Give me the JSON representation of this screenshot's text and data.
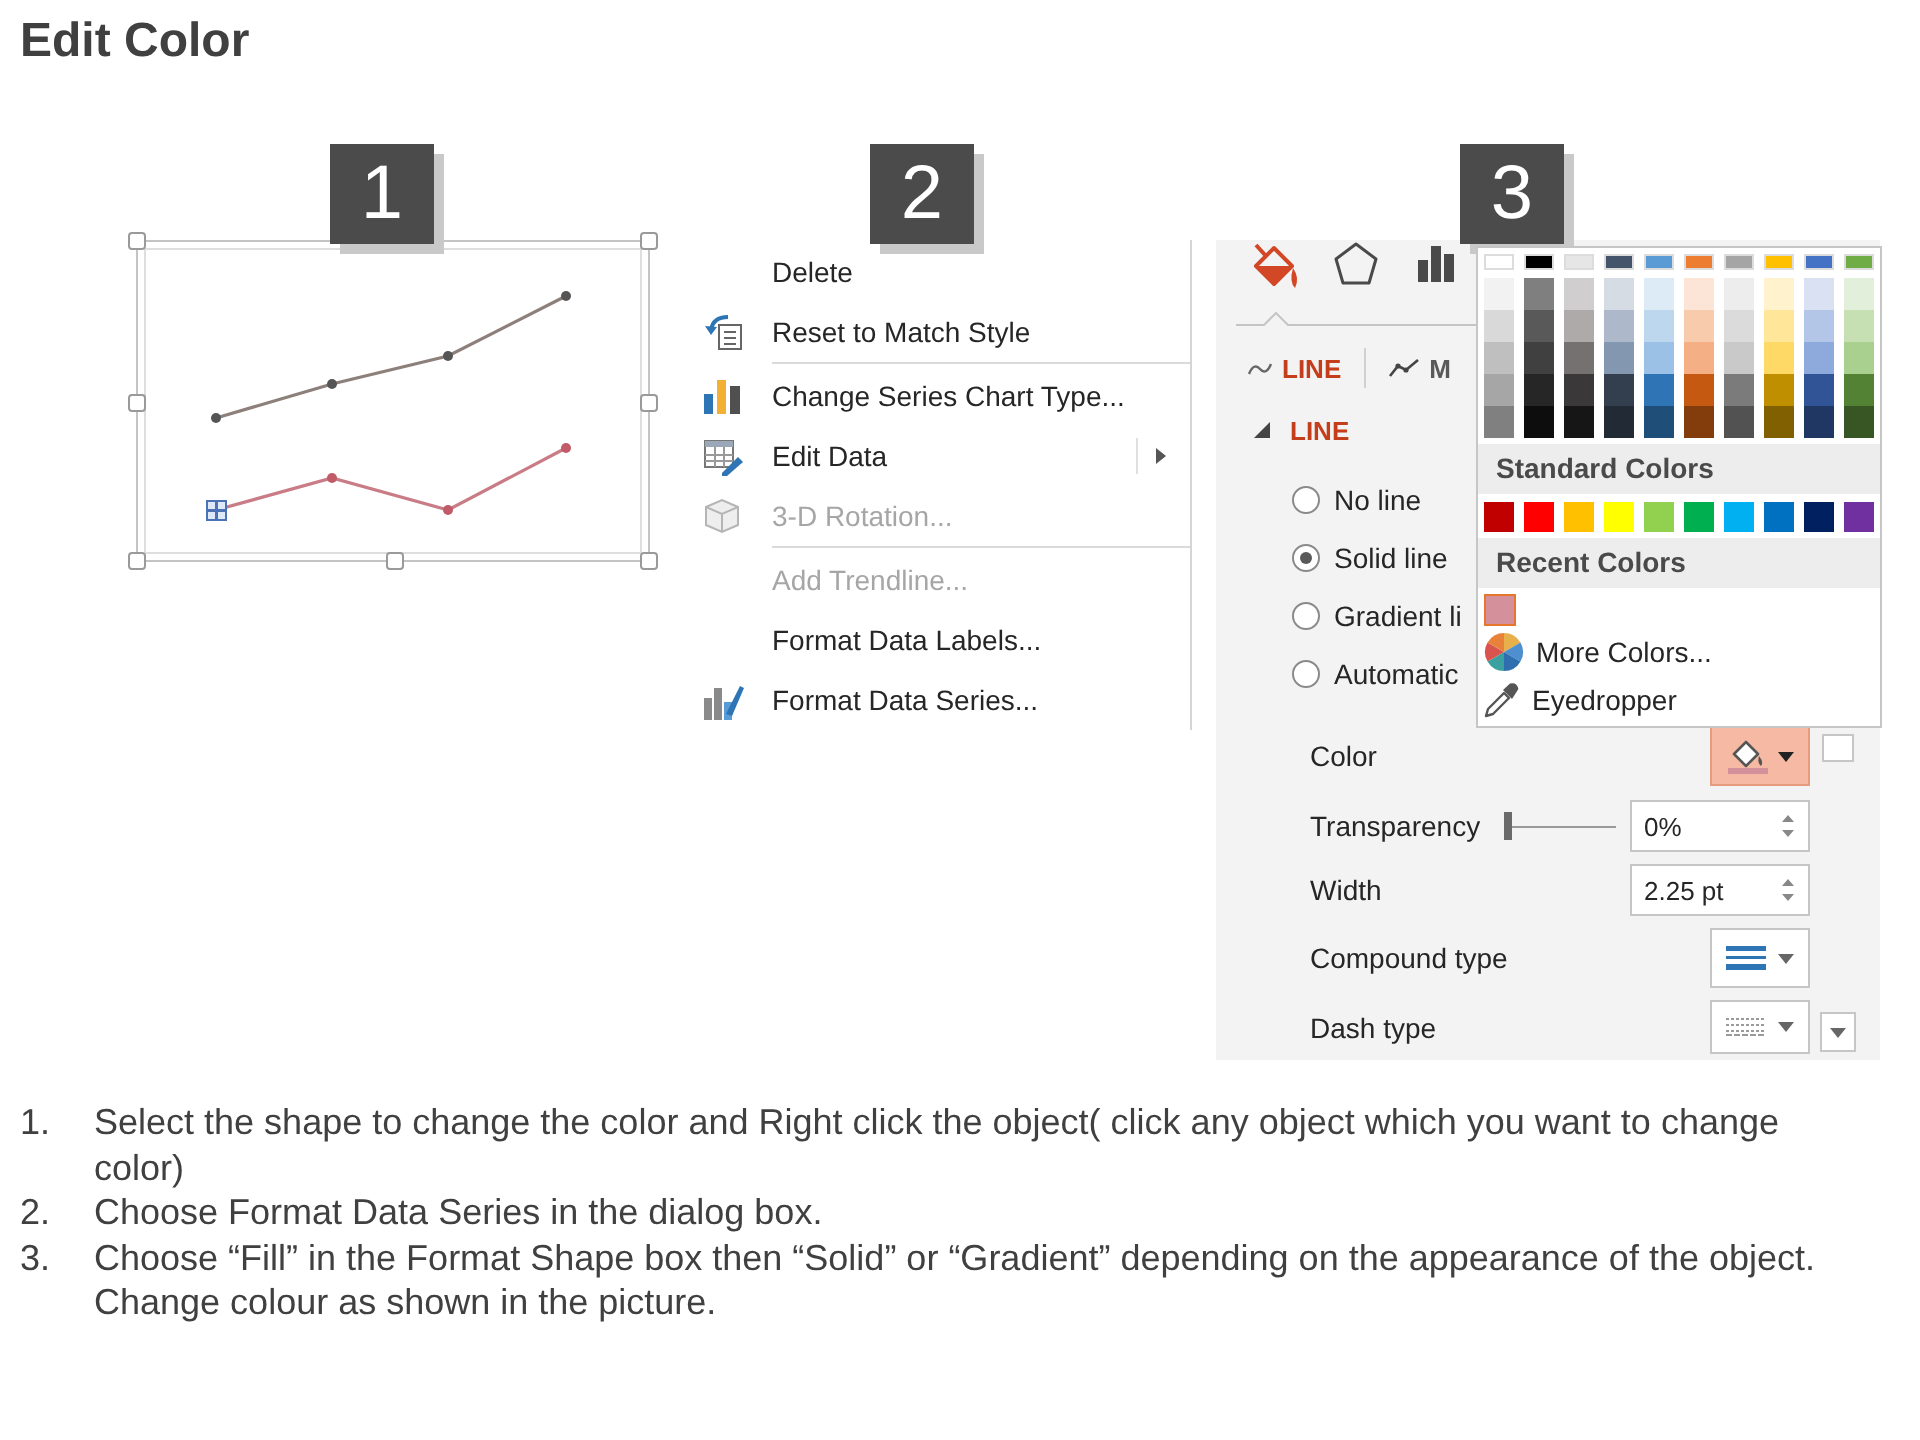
{
  "title": "Edit Color",
  "chart_panel": {
    "badge": "1"
  },
  "context_menu": {
    "badge": "2",
    "groups": [
      {
        "items": [
          {
            "label": "Delete",
            "disabled": false,
            "submenu": false
          },
          {
            "label": "Reset to Match Style",
            "disabled": false,
            "submenu": false
          }
        ]
      },
      {
        "items": [
          {
            "label": "Change Series Chart Type...",
            "disabled": false,
            "submenu": false
          },
          {
            "label": "Edit Data",
            "disabled": false,
            "submenu": true
          },
          {
            "label": "3-D Rotation...",
            "disabled": true,
            "submenu": false
          }
        ]
      },
      {
        "items": [
          {
            "label": "Add Trendline...",
            "disabled": true,
            "submenu": false
          },
          {
            "label": "Format Data Labels...",
            "disabled": false,
            "submenu": false
          },
          {
            "label": "Format Data Series...",
            "disabled": false,
            "submenu": false
          }
        ]
      }
    ]
  },
  "format_pane": {
    "badge": "3",
    "tabs": [
      {
        "selected": true
      },
      {
        "selected": false
      },
      {
        "selected": false
      }
    ],
    "subtabs": [
      {
        "label": "LINE",
        "selected": true
      },
      {
        "label": "M",
        "selected": false
      }
    ],
    "section": {
      "title": "LINE",
      "expanded": true
    },
    "line_options": [
      {
        "label": "No line",
        "selected": false
      },
      {
        "label": "Solid line",
        "selected": true
      },
      {
        "label": "Gradient li",
        "selected": false
      },
      {
        "label": "Automatic",
        "selected": false
      }
    ],
    "color": {
      "label": "Color",
      "open": true,
      "palette": {
        "theme_colors": [
          {
            "color": "#ffffff",
            "shades": [
              {
                "color": "#f2f2f2"
              },
              {
                "color": "#d9d9d9"
              },
              {
                "color": "#bfbfbf"
              },
              {
                "color": "#a6a6a6"
              },
              {
                "color": "#808080"
              }
            ]
          },
          {
            "color": "#000000",
            "shades": [
              {
                "color": "#7f7f7f"
              },
              {
                "color": "#595959"
              },
              {
                "color": "#404040"
              },
              {
                "color": "#262626"
              },
              {
                "color": "#0d0d0d"
              }
            ]
          },
          {
            "color": "#e7e6e6",
            "shades": [
              {
                "color": "#d0cece"
              },
              {
                "color": "#aeaaaa"
              },
              {
                "color": "#757171"
              },
              {
                "color": "#3a3838"
              },
              {
                "color": "#171616"
              }
            ]
          },
          {
            "color": "#44546a",
            "shades": [
              {
                "color": "#d6dce4"
              },
              {
                "color": "#adb9ca"
              },
              {
                "color": "#8497b0"
              },
              {
                "color": "#333f4f"
              },
              {
                "color": "#222a35"
              }
            ]
          },
          {
            "color": "#5b9bd5",
            "shades": [
              {
                "color": "#ddebf7"
              },
              {
                "color": "#bdd7ee"
              },
              {
                "color": "#9bc2e6"
              },
              {
                "color": "#2f75b5"
              },
              {
                "color": "#1f4e78"
              }
            ]
          },
          {
            "color": "#ed7d31",
            "shades": [
              {
                "color": "#fce4d6"
              },
              {
                "color": "#f8cbad"
              },
              {
                "color": "#f4b084"
              },
              {
                "color": "#c65911"
              },
              {
                "color": "#833c0c"
              }
            ]
          },
          {
            "color": "#a5a5a5",
            "shades": [
              {
                "color": "#ededed"
              },
              {
                "color": "#dbdbdb"
              },
              {
                "color": "#c9c9c9"
              },
              {
                "color": "#7b7b7b"
              },
              {
                "color": "#525252"
              }
            ]
          },
          {
            "color": "#ffc000",
            "shades": [
              {
                "color": "#fff2cc"
              },
              {
                "color": "#ffe699"
              },
              {
                "color": "#ffd966"
              },
              {
                "color": "#bf8f00"
              },
              {
                "color": "#806000"
              }
            ]
          },
          {
            "color": "#4472c4",
            "shades": [
              {
                "color": "#d9e1f2"
              },
              {
                "color": "#b4c6e7"
              },
              {
                "color": "#8ea9db"
              },
              {
                "color": "#305496"
              },
              {
                "color": "#203764"
              }
            ]
          },
          {
            "color": "#70ad47",
            "shades": [
              {
                "color": "#e2efda"
              },
              {
                "color": "#c6e0b4"
              },
              {
                "color": "#a9d08e"
              },
              {
                "color": "#548235"
              },
              {
                "color": "#375623"
              }
            ]
          }
        ],
        "standard_heading": "Standard Colors",
        "standard_colors": [
          {
            "color": "#c00000"
          },
          {
            "color": "#ff0000"
          },
          {
            "color": "#ffc000"
          },
          {
            "color": "#ffff00"
          },
          {
            "color": "#92d050"
          },
          {
            "color": "#00b050"
          },
          {
            "color": "#00b0f0"
          },
          {
            "color": "#0070c0"
          },
          {
            "color": "#002060"
          },
          {
            "color": "#7030a0"
          }
        ],
        "recent_heading": "Recent Colors",
        "recent_colors": [
          {
            "color": "#d4919b",
            "selected": true
          }
        ],
        "more_colors": "More Colors...",
        "eyedropper": "Eyedropper"
      }
    },
    "transparency": {
      "label": "Transparency",
      "level": 0,
      "value": "0%"
    },
    "width": {
      "label": "Width",
      "value": "2.25 pt"
    },
    "compound_type": {
      "label": "Compound type"
    },
    "dash_type": {
      "label": "Dash type"
    }
  },
  "instructions": [
    {
      "number": "1.",
      "text": "Select the shape to change the color and Right click the object( click any object which you want to change color)"
    },
    {
      "number": "2.",
      "text": "Choose Format Data Series in the dialog box."
    },
    {
      "number": "3.",
      "text": "Choose “Fill” in the Format Shape box then “Solid” or “Gradient” depending on the appearance of the object. Change colour as shown in the picture."
    }
  ]
}
